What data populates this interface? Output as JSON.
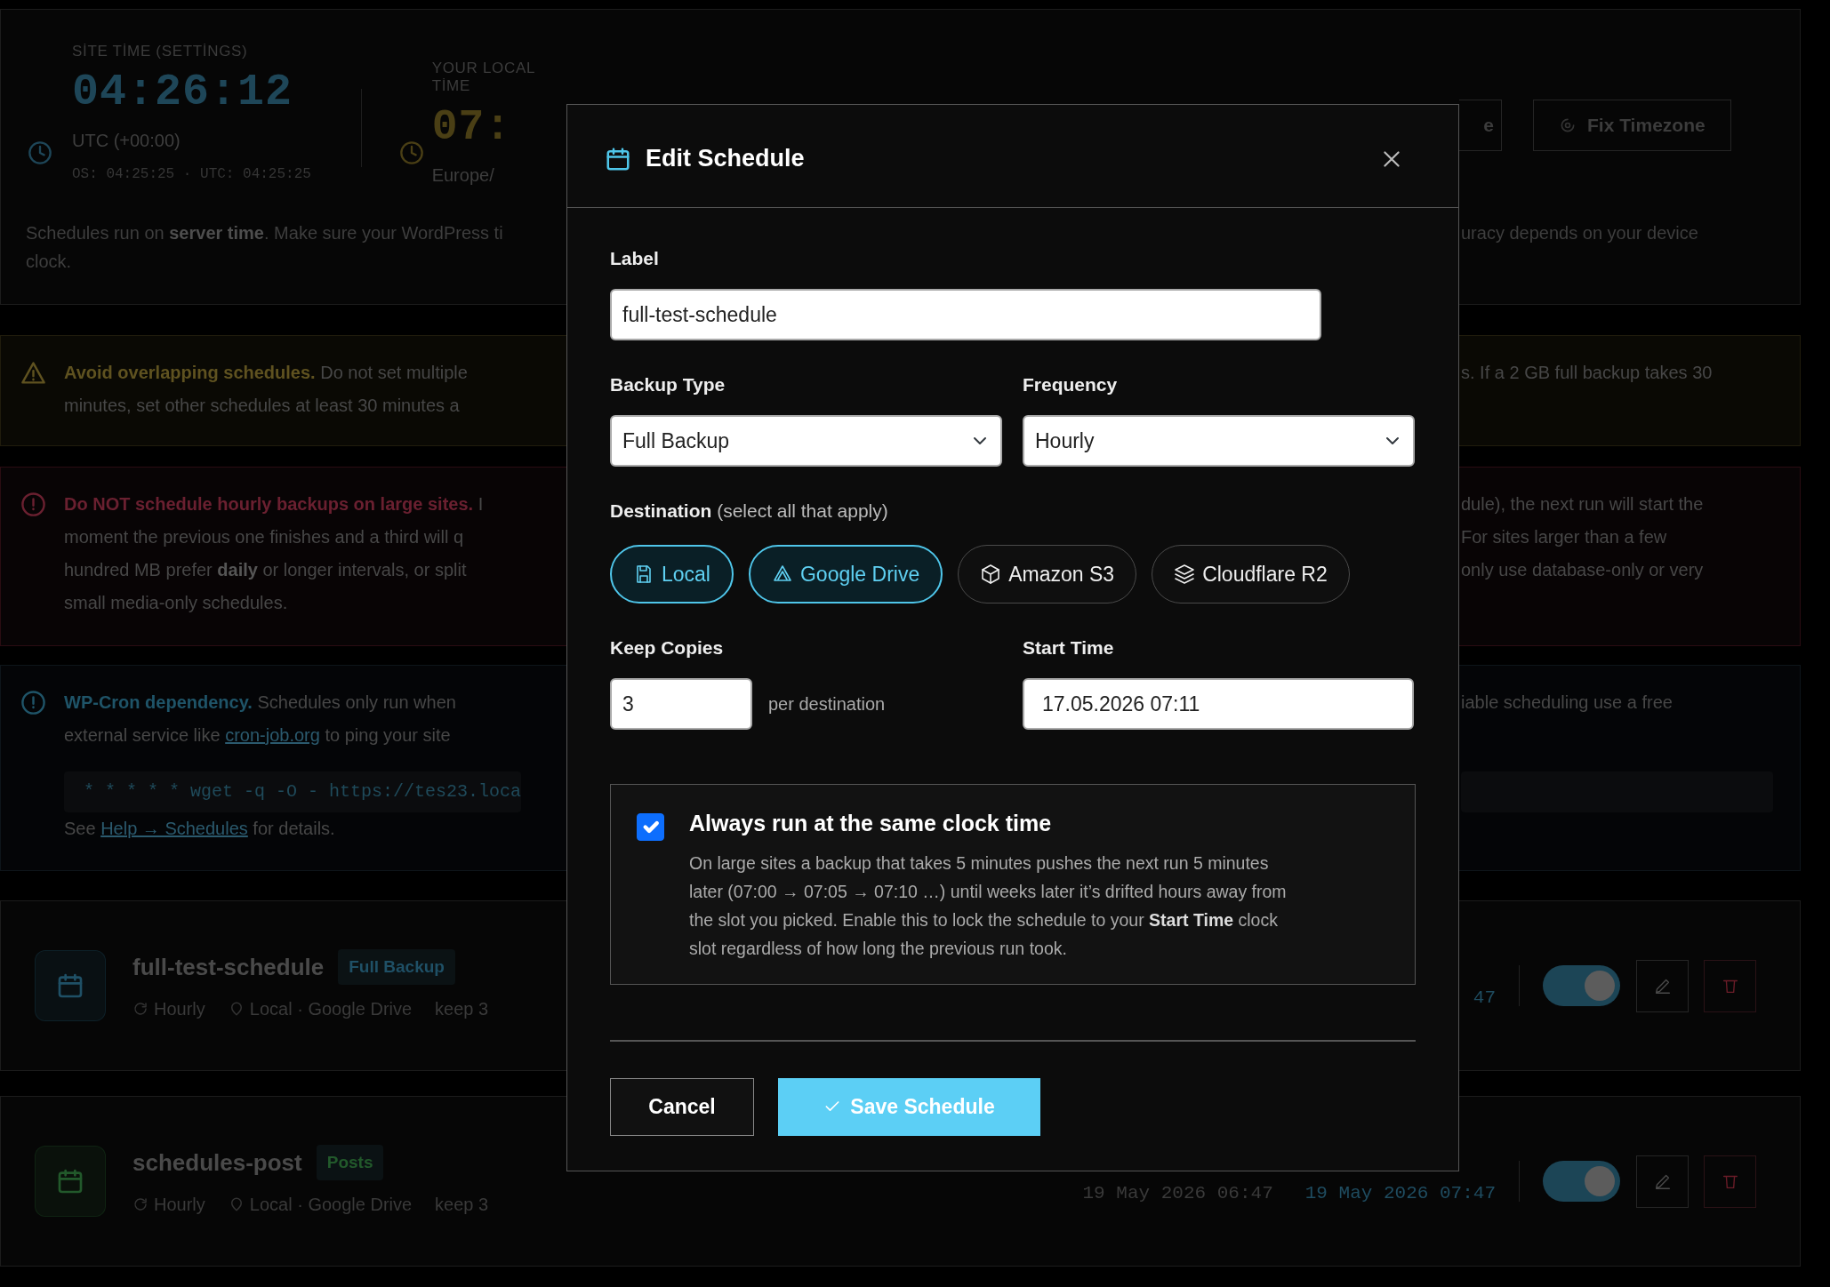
{
  "site_time": {
    "label": "SİTE TİME (SETTİNGS)",
    "time": "04:26:12",
    "zone": "UTC (+00:00)",
    "detail": "OS: 04:25:25 · UTC: 04:25:25"
  },
  "local_time": {
    "label": "YOUR LOCAL TİME",
    "time": "07:",
    "zone": "Europe/"
  },
  "time_buttons": [
    {
      "label": "e"
    },
    {
      "label": "Fix Timezone"
    }
  ],
  "time_note": {
    "left_lines": [
      "Schedules run on **server time**. Make sure your WordPress ti",
      "clock."
    ],
    "right_lines": [
      "uracy depends on your device"
    ]
  },
  "notices": [
    {
      "kind": "warning",
      "left_lines": [
        "**Avoid overlapping schedules.** Do not set multiple",
        "minutes, set other schedules at least 30 minutes a"
      ],
      "right_lines": [
        "s. If a 2 GB full backup takes 30"
      ]
    },
    {
      "kind": "danger",
      "left_lines": [
        "**Do NOT schedule hourly backups on large sites.** I",
        "moment the previous one finishes and a third will q",
        "hundred MB prefer **daily** or longer intervals, or split",
        "small media-only schedules."
      ],
      "right_lines": [
        "dule), the next run will start the",
        "For sites larger than a few",
        "only use database-only or very"
      ]
    },
    {
      "kind": "info",
      "left_lines": [
        "**WP-Cron dependency.** Schedules only run when",
        {
          "parts": [
            {
              "text": "external service like "
            },
            {
              "text": "cron-job.org",
              "link": true
            },
            {
              "text": " to ping your site"
            }
          ]
        }
      ],
      "code": "* * * * * wget -q -O - https://tes23.loca",
      "after_lines": [
        {
          "parts": [
            {
              "text": "See "
            },
            {
              "text": "Help → Schedules",
              "link": true
            },
            {
              "text": " for details."
            }
          ]
        }
      ],
      "right_lines": [
        "iable scheduling use a free"
      ]
    }
  ],
  "schedules": [
    {
      "name": "full-test-schedule",
      "badge": {
        "text": "Full Backup",
        "color": "#1f5066"
      },
      "frequency": "Hourly",
      "destinations": "Local · Google Drive",
      "keep": "keep 3",
      "next_run": "47",
      "enabled": true
    },
    {
      "name": "schedules-post",
      "badge": {
        "text": "Posts",
        "color": "#22592b"
      },
      "frequency": "Hourly",
      "destinations": "Local · Google Drive",
      "keep": "keep 3",
      "last_run": "19 May 2026 06:47",
      "next_run": "19 May 2026 07:47",
      "enabled": true
    }
  ],
  "dialog": {
    "title": "Edit Schedule",
    "label_field": {
      "label": "Label",
      "value": "full-test-schedule"
    },
    "backup_type": {
      "label": "Backup Type",
      "value": "Full Backup"
    },
    "frequency": {
      "label": "Frequency",
      "value": "Hourly"
    },
    "destination": {
      "label": "**Destination** (select all that apply)",
      "options": [
        {
          "label": "Local",
          "selected": true
        },
        {
          "label": "Google Drive",
          "selected": true
        },
        {
          "label": "Amazon S3",
          "selected": false
        },
        {
          "label": "Cloudflare R2",
          "selected": false
        }
      ]
    },
    "keep_copies": {
      "label": "Keep Copies",
      "value": "3",
      "suffix": "per destination"
    },
    "start_time": {
      "label": "Start Time",
      "value": "17.05.2026 07:11"
    },
    "same_clock": {
      "checked": true,
      "title": "Always run at the same clock time",
      "description_lines": [
        "On large sites a backup that takes 5 minutes pushes the next run 5 minutes",
        "later (07:00 → 07:05 → 07:10 …) until weeks later it’s drifted hours away from",
        "the slot you picked. Enable this to lock the schedule to your **Start Time** clock",
        "slot regardless of how long the previous run took."
      ]
    },
    "buttons": [
      {
        "label": "Cancel",
        "kind": "secondary"
      },
      {
        "label": "Save Schedule",
        "kind": "primary"
      }
    ]
  }
}
